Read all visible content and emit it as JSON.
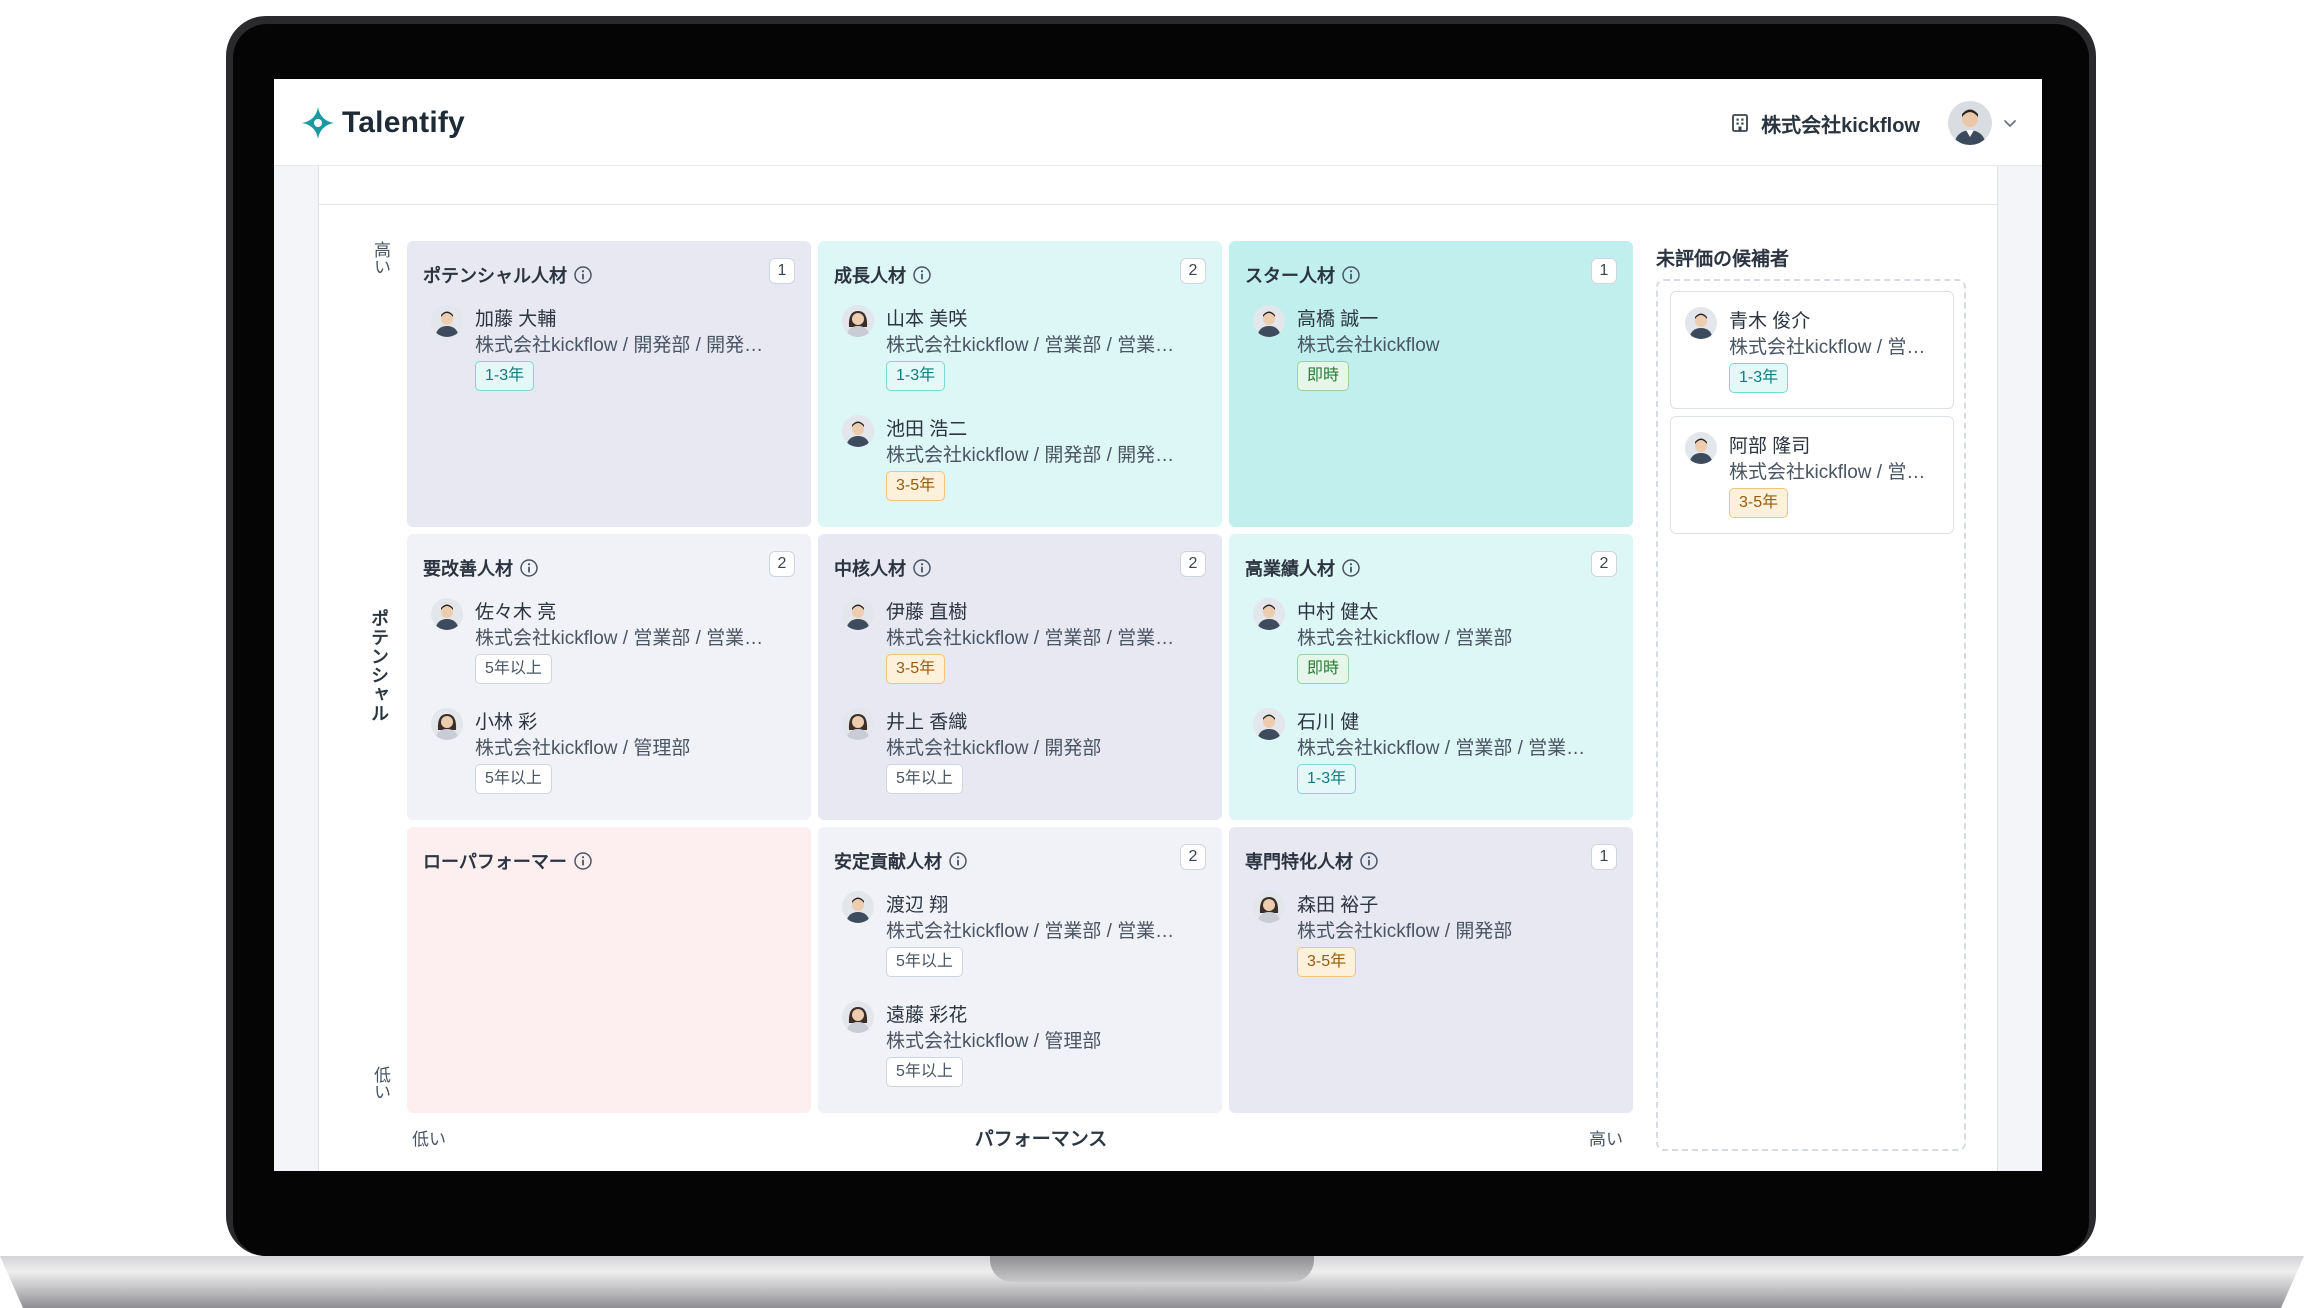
{
  "app": {
    "name": "Talentify"
  },
  "header": {
    "company": "株式会社kickflow"
  },
  "axes": {
    "y_title": "ポテンシャル",
    "y_high": "高い",
    "y_low": "低い",
    "x_title": "パフォーマンス",
    "x_low": "低い",
    "x_high": "高い"
  },
  "colors": {
    "brand": "#1a9aa0",
    "cell_lavender": "#e8e8f3",
    "cell_cyan": "#ddf6f6",
    "cell_teal": "#c0efee",
    "cell_gray": "#f1f2f7",
    "cell_pink": "#fdeef0"
  },
  "grid": {
    "c00": {
      "title": "ポテンシャル人材",
      "count": "1",
      "people": [
        {
          "name": "加藤 大輔",
          "org": "株式会社kickflow / 開発部 / 開発…",
          "badge": "1-3年"
        }
      ]
    },
    "c01": {
      "title": "成長人材",
      "count": "2",
      "people": [
        {
          "name": "山本 美咲",
          "org": "株式会社kickflow / 営業部 / 営業…",
          "badge": "1-3年"
        },
        {
          "name": "池田 浩二",
          "org": "株式会社kickflow / 開発部 / 開発…",
          "badge": "3-5年"
        }
      ]
    },
    "c02": {
      "title": "スター人材",
      "count": "1",
      "people": [
        {
          "name": "高橋 誠一",
          "org": "株式会社kickflow",
          "badge": "即時"
        }
      ]
    },
    "c10": {
      "title": "要改善人材",
      "count": "2",
      "people": [
        {
          "name": "佐々木 亮",
          "org": "株式会社kickflow / 営業部 / 営業…",
          "badge": "5年以上"
        },
        {
          "name": "小林 彩",
          "org": "株式会社kickflow / 管理部",
          "badge": "5年以上"
        }
      ]
    },
    "c11": {
      "title": "中核人材",
      "count": "2",
      "people": [
        {
          "name": "伊藤 直樹",
          "org": "株式会社kickflow / 営業部 / 営業…",
          "badge": "3-5年"
        },
        {
          "name": "井上 香織",
          "org": "株式会社kickflow / 開発部",
          "badge": "5年以上"
        }
      ]
    },
    "c12": {
      "title": "高業績人材",
      "count": "2",
      "people": [
        {
          "name": "中村 健太",
          "org": "株式会社kickflow / 営業部",
          "badge": "即時"
        },
        {
          "name": "石川 健",
          "org": "株式会社kickflow / 営業部 / 営業…",
          "badge": "1-3年"
        }
      ]
    },
    "c20": {
      "title": "ローパフォーマー",
      "count": "",
      "people": []
    },
    "c21": {
      "title": "安定貢献人材",
      "count": "2",
      "people": [
        {
          "name": "渡辺 翔",
          "org": "株式会社kickflow / 営業部 / 営業…",
          "badge": "5年以上"
        },
        {
          "name": "遠藤 彩花",
          "org": "株式会社kickflow / 管理部",
          "badge": "5年以上"
        }
      ]
    },
    "c22": {
      "title": "専門特化人材",
      "count": "1",
      "people": [
        {
          "name": "森田 裕子",
          "org": "株式会社kickflow / 開発部",
          "badge": "3-5年"
        }
      ]
    }
  },
  "unevaluated": {
    "title": "未評価の候補者",
    "people": [
      {
        "name": "青木 俊介",
        "org": "株式会社kickflow / 営…",
        "badge": "1-3年"
      },
      {
        "name": "阿部 隆司",
        "org": "株式会社kickflow / 営…",
        "badge": "3-5年"
      }
    ]
  }
}
